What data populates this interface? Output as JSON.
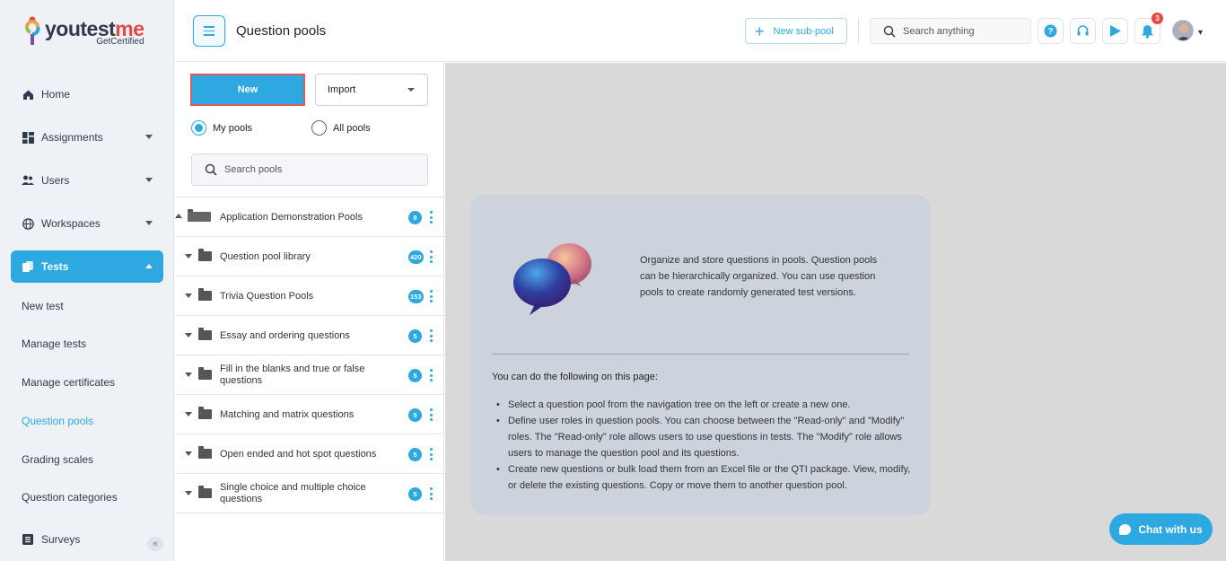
{
  "brand": {
    "name_part1": "youtest",
    "name_part2": "me",
    "tagline": "GetCertified"
  },
  "sidebar": {
    "items": [
      {
        "label": "Home",
        "icon": "home-icon"
      },
      {
        "label": "Assignments",
        "icon": "assignments-icon"
      },
      {
        "label": "Users",
        "icon": "users-icon"
      },
      {
        "label": "Workspaces",
        "icon": "globe-icon"
      },
      {
        "label": "Tests",
        "icon": "tests-icon"
      },
      {
        "label": "Surveys",
        "icon": "surveys-icon"
      }
    ],
    "sub_items": [
      "New test",
      "Manage tests",
      "Manage certificates",
      "Question pools",
      "Grading scales",
      "Question categories"
    ],
    "collapse_label": "«"
  },
  "header": {
    "title": "Question pools",
    "new_subpool_label": "New sub-pool",
    "search_placeholder": "Search anything",
    "notification_count": "3"
  },
  "pools_panel": {
    "new_label": "New",
    "import_label": "Import",
    "radio_my": "My pools",
    "radio_all": "All pools",
    "selected_radio": "My pools",
    "search_placeholder": "Search pools",
    "pools": [
      {
        "name": "Application Demonstration Pools",
        "count": "9"
      },
      {
        "name": "Question pool library",
        "count": "420"
      },
      {
        "name": "Trivia Question Pools",
        "count": "153"
      },
      {
        "name": "Essay and ordering questions",
        "count": "5"
      },
      {
        "name": "Fill in the blanks and true or false questions",
        "count": "5"
      },
      {
        "name": "Matching and matrix questions",
        "count": "5"
      },
      {
        "name": "Open ended and hot spot questions",
        "count": "5"
      },
      {
        "name": "Single choice and multiple choice questions",
        "count": "5"
      }
    ]
  },
  "info_card": {
    "description": "Organize and store questions in pools. Question pools can be hierarchically organized. You can use question pools to create randomly generated test versions.",
    "heading": "You can do the following on this page:",
    "bullets": [
      "Select a question pool from the navigation tree on the left or create a new one.",
      "Define user roles in question pools. You can choose between the \"Read-only\" and \"Modify\" roles. The \"Read-only\" role allows users to use questions in tests. The \"Modify\" role allows users to manage the question pool and its questions.",
      "Create new questions or bulk load them from an Excel file or the QTI package. View, modify, or delete the existing questions. Copy or move them to another question pool."
    ]
  },
  "chat": {
    "label": "Chat with us"
  },
  "colors": {
    "accent": "#2ea8e0",
    "danger": "#e8483f",
    "sidebar_bg": "#eef1f6",
    "main_bg": "#d9d9d9"
  }
}
